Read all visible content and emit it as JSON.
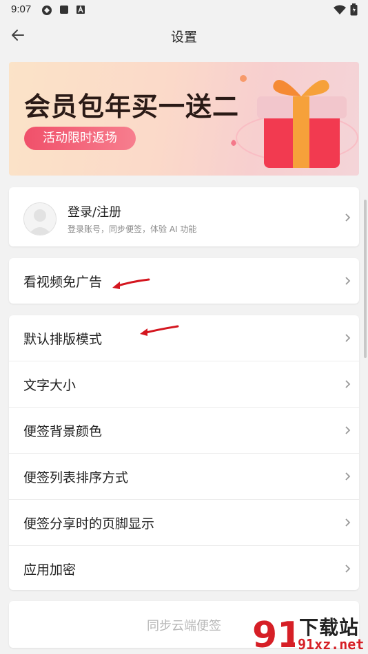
{
  "status_bar": {
    "time": "9:07"
  },
  "header": {
    "title": "设置"
  },
  "banner": {
    "headline": "会员包年买一送二",
    "pill_label": "活动限时返场"
  },
  "account": {
    "title": "登录/注册",
    "subtitle": "登录账号，同步便签，体验 AI 功能"
  },
  "ad_free": {
    "label": "看视频免广告"
  },
  "settings": {
    "items": [
      {
        "label": "默认排版模式"
      },
      {
        "label": "文字大小"
      },
      {
        "label": "便签背景颜色"
      },
      {
        "label": "便签列表排序方式"
      },
      {
        "label": "便签分享时的页脚显示"
      },
      {
        "label": "应用加密"
      }
    ]
  },
  "sync_button": {
    "label": "同步云端便签"
  },
  "watermark": {
    "text_cn": "下载站",
    "text_url": "91xz.net",
    "logo": "91"
  },
  "colors": {
    "background": "#f2f2f2",
    "pill": "#f0506a",
    "arrow": "#d4161f",
    "watermark_red": "#d61f26"
  }
}
